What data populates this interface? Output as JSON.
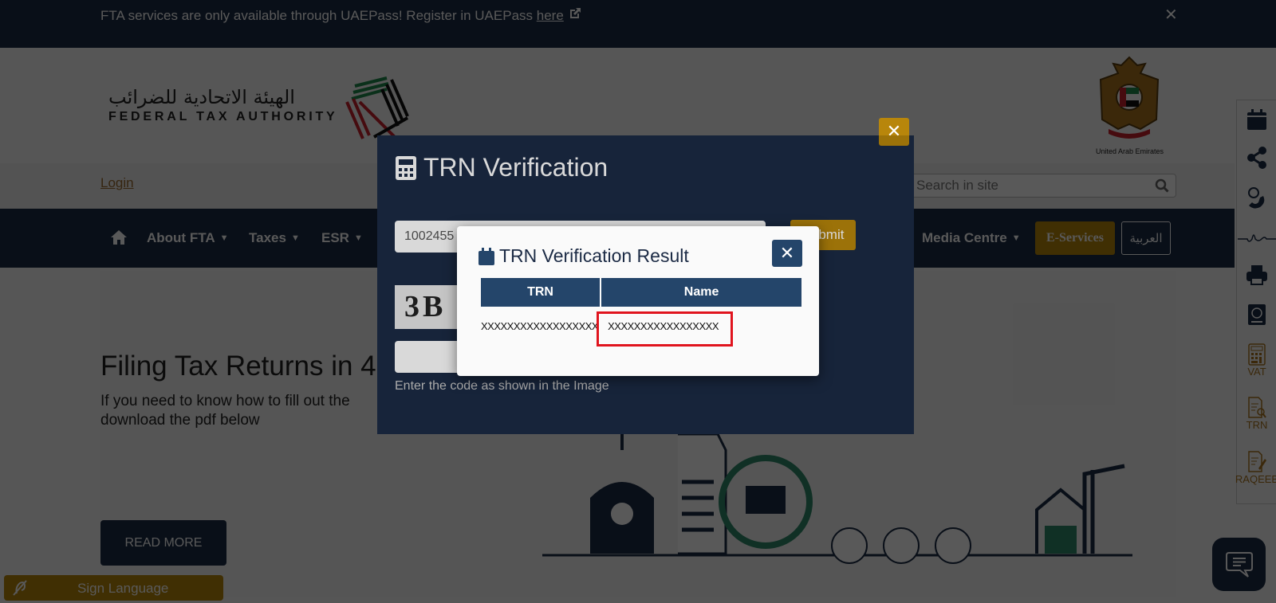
{
  "announcement": {
    "message": "FTA services are only available through UAEPass! Register in UAEPass ",
    "link_label": "here",
    "close_label": "✕"
  },
  "header": {
    "logo_arabic": "الهيئة الاتحادية للضرائب",
    "logo_english": "FEDERAL TAX AUTHORITY",
    "emblem_caption": "United Arab Emirates",
    "login_label": "Login",
    "search_placeholder": "Search in site"
  },
  "nav": {
    "items": [
      {
        "label": "About FTA"
      },
      {
        "label": "Taxes"
      },
      {
        "label": "ESR"
      },
      {
        "label": "Media Centre"
      }
    ],
    "eservices_label": "E-Services",
    "arabic_label": "العربية"
  },
  "hero": {
    "title": "Filing Tax Returns in 4",
    "description": "If you need to know how to fill out the download the pdf below",
    "read_more_label": "READ MORE"
  },
  "sign_language_label": "Sign Language",
  "side_rail": {
    "items": [
      {
        "icon": "calendar-icon",
        "label": ""
      },
      {
        "icon": "share-icon",
        "label": ""
      },
      {
        "icon": "phone-info-icon",
        "label": ""
      },
      {
        "icon": "signature-icon",
        "label": ""
      },
      {
        "icon": "print-icon",
        "label": ""
      },
      {
        "icon": "passport-icon",
        "label": ""
      },
      {
        "icon": "calculator-icon",
        "label": "VAT"
      },
      {
        "icon": "document-search-icon",
        "label": "TRN"
      },
      {
        "icon": "document-edit-icon",
        "label": "RAQEEB"
      }
    ]
  },
  "trn_modal": {
    "title": "TRN Verification",
    "trn_value": "1002455",
    "submit_label": "Submit",
    "captcha_text": "3B",
    "captcha_hint": "Enter the code as shown in the Image",
    "close_label": "✕"
  },
  "result_modal": {
    "title": "TRN Verification Result",
    "close_label": "✕",
    "columns": [
      "TRN",
      "Name"
    ],
    "rows": [
      {
        "trn": "XXXXXXXXXXXXXXXXXX",
        "name": "XXXXXXXXXXXXXXXXX"
      }
    ]
  }
}
